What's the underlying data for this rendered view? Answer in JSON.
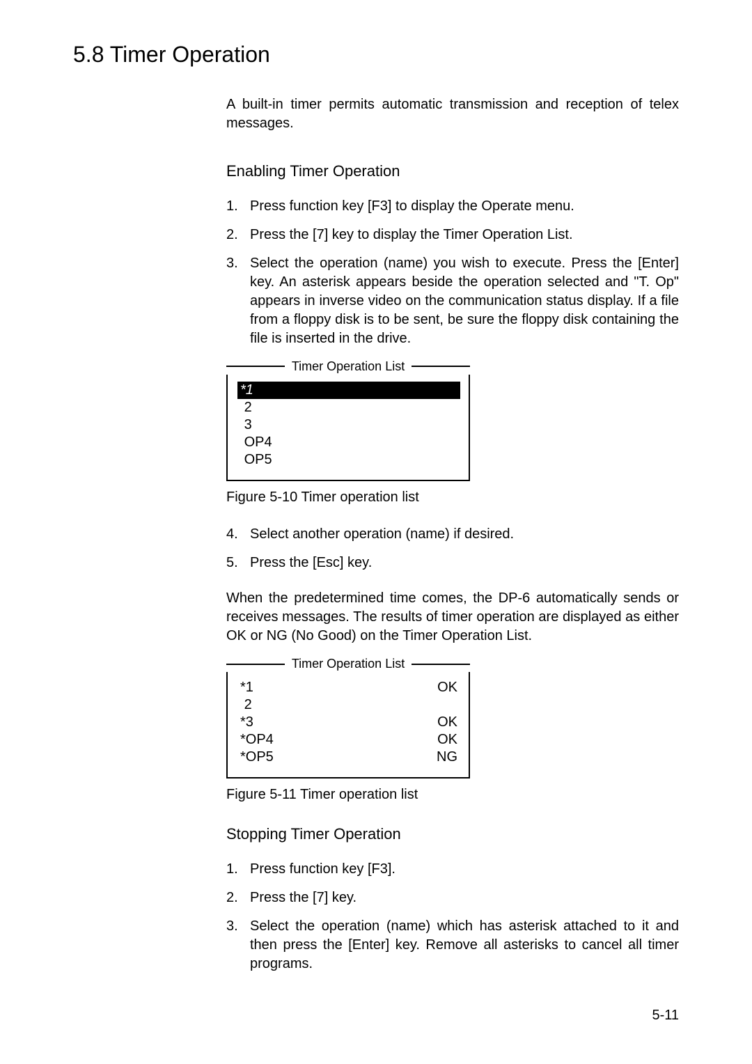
{
  "section_heading": "5.8 Timer Operation",
  "intro": "A built-in timer permits automatic transmission and reception of telex messages.",
  "enable_heading": "Enabling Timer Operation",
  "enable_steps": [
    "Press function key [F3] to display the Operate menu.",
    "Press the [7] key to display the Timer Operation List.",
    "Select the operation (name) you wish to execute. Press the [Enter] key. An asterisk appears beside the operation selected and \"T. Op\" appears in inverse video on the communication status display. If a file from a floppy disk is to be sent, be sure the floppy disk containing the file is inserted in the drive."
  ],
  "timer_list1": {
    "title": "Timer Operation List",
    "rows": [
      {
        "name": "*1",
        "status": "",
        "selected": true
      },
      {
        "name": "2",
        "status": ""
      },
      {
        "name": "3",
        "status": ""
      },
      {
        "name": "OP4",
        "status": ""
      },
      {
        "name": "OP5",
        "status": ""
      }
    ]
  },
  "figure1_caption": "Figure 5-10 Timer operation list",
  "enable_steps_cont": [
    "Select another operation (name) if desired.",
    "Press the [Esc] key."
  ],
  "mid_para": "When the predetermined time comes, the DP-6 automatically sends or receives messages. The results of timer operation are displayed as either OK or NG (No Good) on the Timer Operation List.",
  "timer_list2": {
    "title": "Timer Operation List",
    "rows": [
      {
        "name": "*1",
        "status": "OK"
      },
      {
        "name": "2",
        "status": ""
      },
      {
        "name": "*3",
        "status": "OK"
      },
      {
        "name": "*OP4",
        "status": "OK"
      },
      {
        "name": "*OP5",
        "status": "NG"
      }
    ]
  },
  "figure2_caption": "Figure 5-11 Timer operation list",
  "stop_heading": "Stopping Timer Operation",
  "stop_steps": [
    "Press function key [F3].",
    "Press the [7] key.",
    "Select the operation (name) which has asterisk attached to it and then press the [Enter] key. Remove all asterisks to cancel all timer programs."
  ],
  "page_number": "5-11"
}
